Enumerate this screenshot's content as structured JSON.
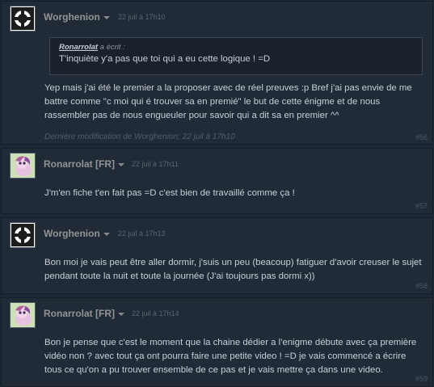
{
  "posts": [
    {
      "author": "Worghenion",
      "timestamp": "22 juil à 17h10",
      "quote": {
        "author": "Ronarrolat",
        "suffix": " a écrit :",
        "text": "T'inquiète y'a pas que toi qui a eu cette logique ! =D"
      },
      "body": "Yep mais j'ai été le premier a la proposer avec de réel preuves :p Bref j'ai pas envie de me battre comme \"c moi qui é trouver sa en premié\" le but de cette énigme et de nous rassembler pas de nous engueuler pour savoir qui a dit sa en premier ^^",
      "edited": "Dernière modification de Worghenion; 22 juil à 17h10",
      "number": "#56"
    },
    {
      "author": "Ronarrolat [FR]",
      "timestamp": "22 juil à 17h11",
      "body": "J'm'en fiche t'en fait pas =D c'est bien de travaillé comme ça !",
      "number": "#57"
    },
    {
      "author": "Worghenion",
      "timestamp": "22 juil à 17h13",
      "body": "Bon moi je vais peut être aller dormir, j'suis un peu (beacoup) fatiguer d'avoir creuser le sujet pendant toute la nuit et toute la journée (J'ai toujours pas dormi x))",
      "number": "#58"
    },
    {
      "author": "Ronarrolat [FR]",
      "timestamp": "22 juil à 17h14",
      "body": "Bon je pense que c'est le moment que la chaine dédier a l'enigme débute avec ça première vidéo non ? avec tout ça ont pourra faire une petite video ! =D je vais commencé a écrire tous ce qu'on a pu trouver ensemble de ce pas et je vais mettre ça dans une video.",
      "number": "#59"
    }
  ],
  "avatars": {
    "worghenion": "companion-cube-icon",
    "ronarrolat": "pony-avatar-icon"
  }
}
